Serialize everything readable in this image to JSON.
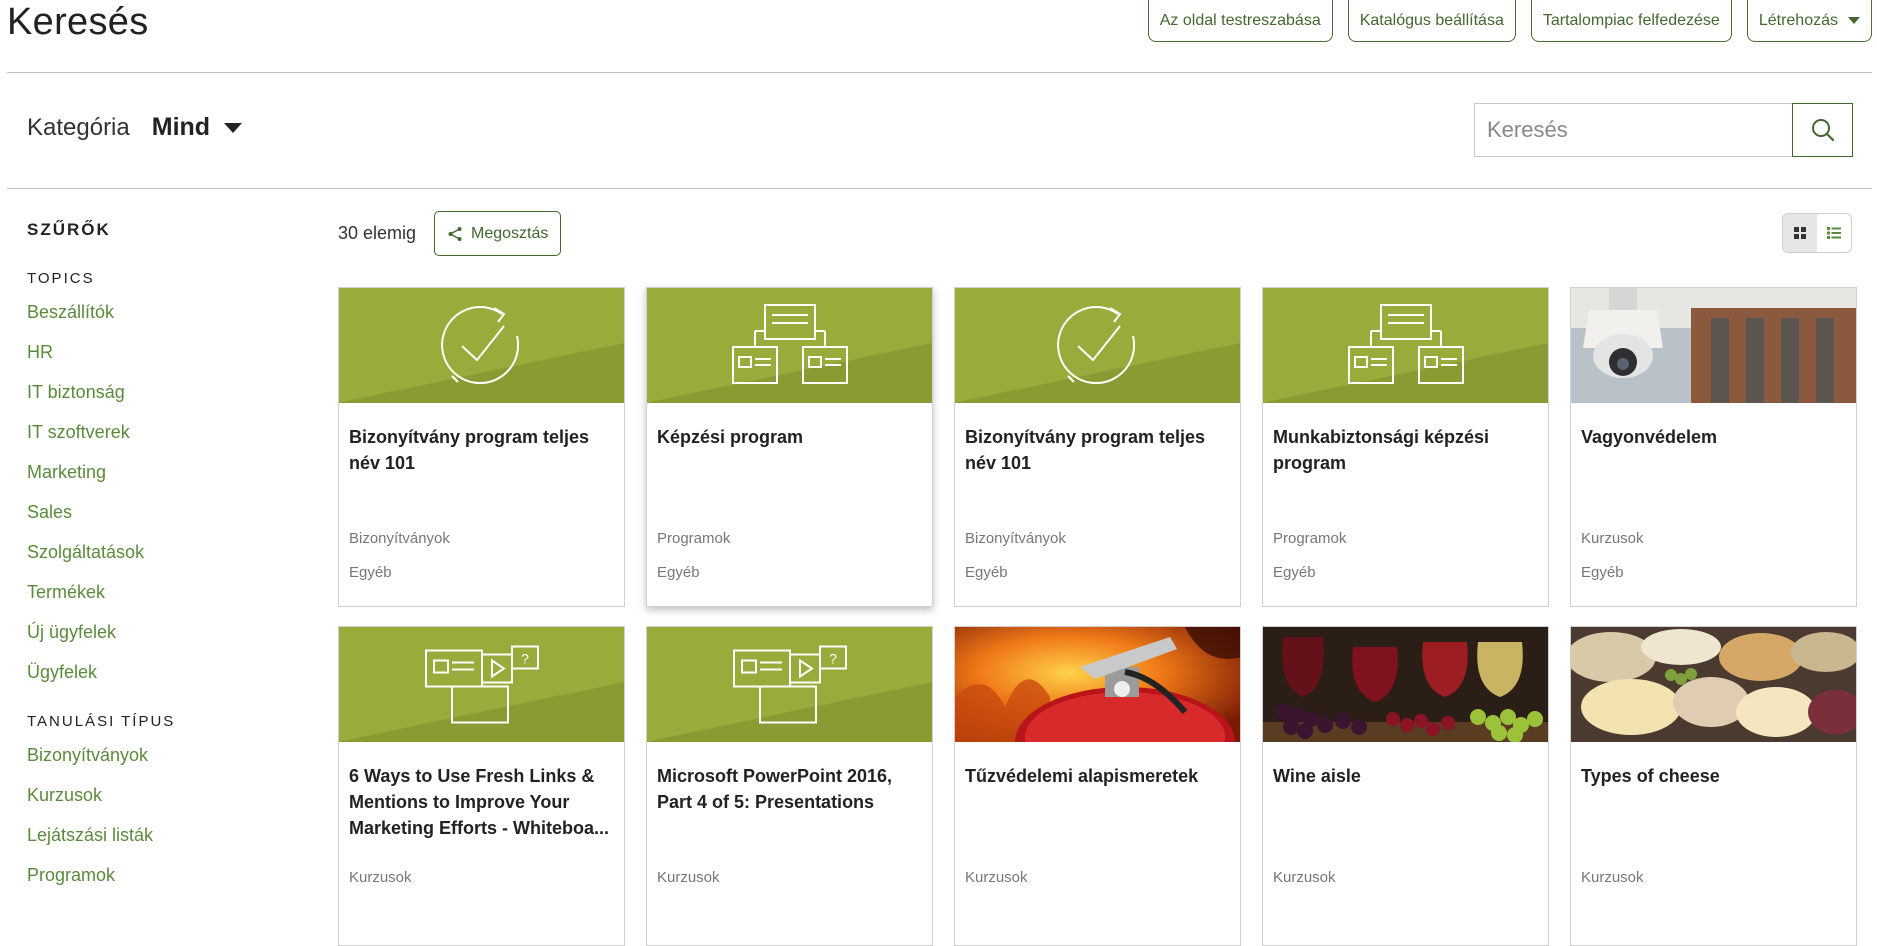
{
  "header": {
    "title": "Keresés",
    "actions": [
      "Az oldal testreszabása",
      "Katalógus beállítása",
      "Tartalompiac felfedezése",
      "Létrehozás"
    ]
  },
  "category": {
    "label": "Kategória",
    "value": "Mind"
  },
  "search": {
    "placeholder": "Keresés"
  },
  "filters": {
    "title": "SZŰRŐK",
    "topics": {
      "title": "TOPICS",
      "items": [
        "Beszállítók",
        "HR",
        "IT biztonság",
        "IT szoftverek",
        "Marketing",
        "Sales",
        "Szolgáltatások",
        "Termékek",
        "Új ügyfelek",
        "Ügyfelek"
      ]
    },
    "learning_type": {
      "title": "TANULÁSI TÍPUS",
      "items": [
        "Bizonyítványok",
        "Kurzusok",
        "Lejátszási listák",
        "Programok"
      ]
    }
  },
  "results": {
    "count": "30 elemig",
    "share_label": "Megosztás"
  },
  "cards": [
    {
      "title": "Bizonyítvány program teljes név 101",
      "type": "Bizonyítványok",
      "category": "Egyéb",
      "thumb": "certificate-icon"
    },
    {
      "title": "Képzési program",
      "type": "Programok",
      "category": "Egyéb",
      "thumb": "program-icon"
    },
    {
      "title": "Bizonyítvány program teljes név 101",
      "type": "Bizonyítványok",
      "category": "Egyéb",
      "thumb": "certificate-icon"
    },
    {
      "title": "Munkabiztonsági képzési program",
      "type": "Programok",
      "category": "Egyéb",
      "thumb": "program-icon"
    },
    {
      "title": "Vagyonvédelem",
      "type": "Kurzusok",
      "category": "Egyéb",
      "thumb": "security-camera-photo"
    },
    {
      "title": "6 Ways to Use Fresh Links & Mentions to Improve Your Marketing Efforts - Whiteboa...",
      "type": "Kurzusok",
      "category": "",
      "thumb": "course-icon"
    },
    {
      "title": "Microsoft PowerPoint 2016, Part 4 of 5: Presentations",
      "type": "Kurzusok",
      "category": "",
      "thumb": "course-icon"
    },
    {
      "title": "Tűzvédelemi alapismeretek",
      "type": "Kurzusok",
      "category": "",
      "thumb": "fire-extinguisher-photo"
    },
    {
      "title": "Wine aisle",
      "type": "Kurzusok",
      "category": "",
      "thumb": "wine-photo"
    },
    {
      "title": "Types of cheese",
      "type": "Kurzusok",
      "category": "",
      "thumb": "cheese-photo"
    }
  ],
  "colors": {
    "accent": "#44672f",
    "link": "#5b8a3c",
    "thumb_green": "#97ac3a"
  }
}
